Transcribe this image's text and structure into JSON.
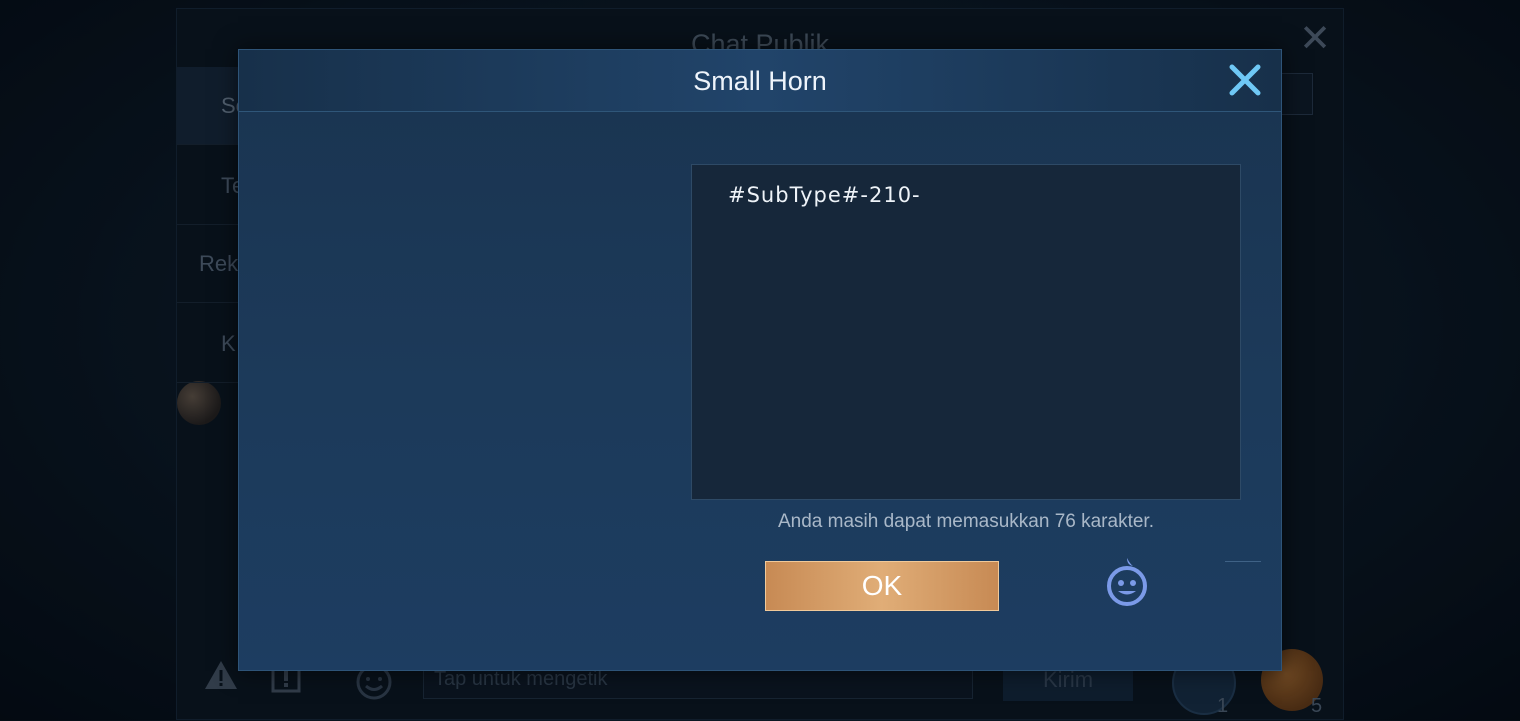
{
  "background": {
    "title": "Chat Publik",
    "sidebar": [
      "Se",
      "Te",
      "Rek",
      "K"
    ],
    "input_placeholder": "Tap untuk mengetik",
    "send_label": "Kirim",
    "blue_horn_count": "1",
    "gold_horn_count": "5"
  },
  "dialog": {
    "title": "Small Horn",
    "input_value": "#SubType#-210-",
    "hint": "Anda masih dapat memasukkan 76 karakter.",
    "ok_label": "OK"
  },
  "colors": {
    "accent_ok": "#d9a06a",
    "close_icon": "#6fc8f5",
    "emoji_icon": "#7b9ae8"
  },
  "icons": [
    "close-icon",
    "emoji-icon",
    "warning-icon",
    "report-icon",
    "horn-icon"
  ]
}
